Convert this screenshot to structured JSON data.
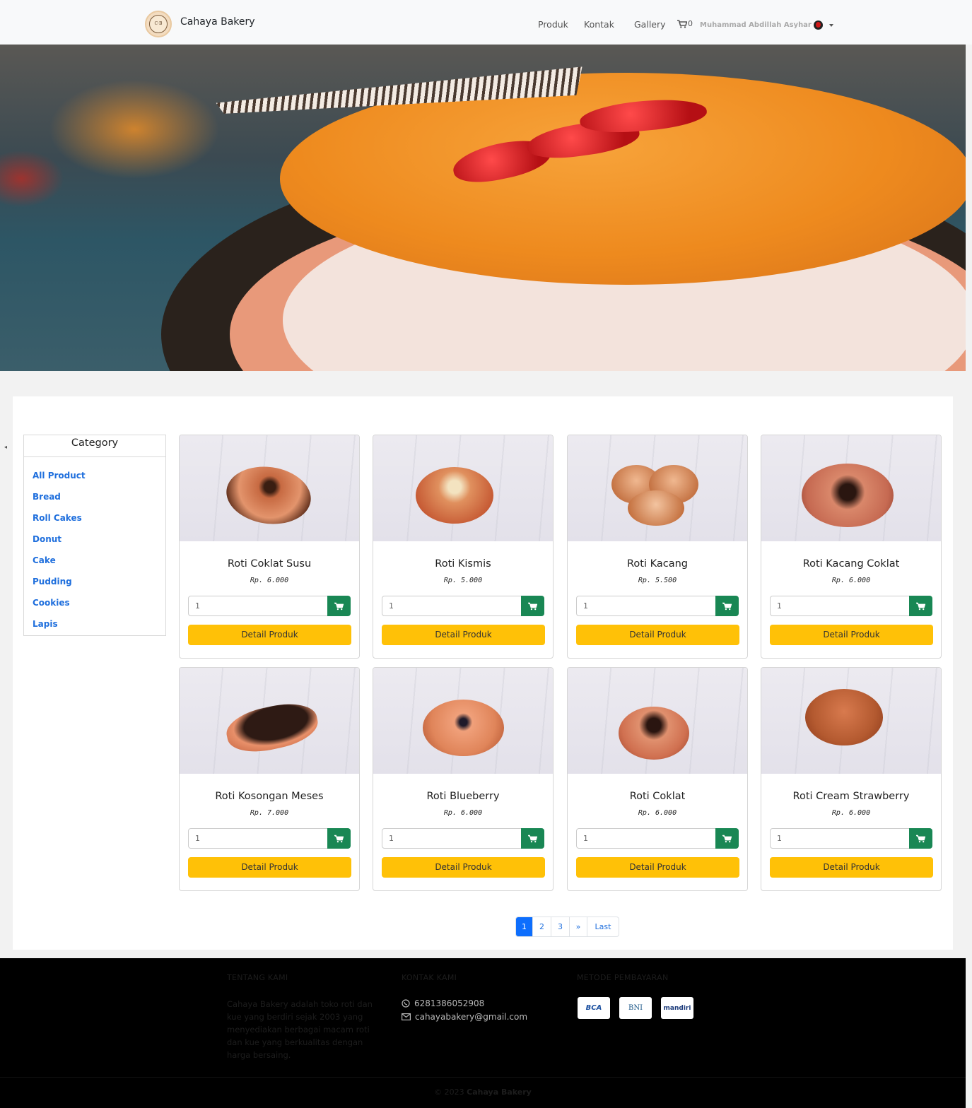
{
  "brand": {
    "name": "Cahaya Bakery",
    "logo_text": "Cahaya Bakery"
  },
  "nav": {
    "links": [
      "Produk",
      "Kontak",
      "Gallery"
    ],
    "cart_count": "0",
    "user_name": "Muhammad Abdillah Asyhar"
  },
  "sidebar": {
    "title": "Category",
    "items": [
      "All Product",
      "Bread",
      "Roll Cakes",
      "Donut",
      "Cake",
      "Pudding",
      "Cookies",
      "Lapis"
    ]
  },
  "products": [
    {
      "name": "Roti Coklat Susu",
      "price": "Rp. 6.000",
      "qty": "1",
      "detail": "Detail Produk"
    },
    {
      "name": "Roti Kismis",
      "price": "Rp. 5.000",
      "qty": "1",
      "detail": "Detail Produk"
    },
    {
      "name": "Roti Kacang",
      "price": "Rp. 5.500",
      "qty": "1",
      "detail": "Detail Produk"
    },
    {
      "name": "Roti Kacang Coklat",
      "price": "Rp. 6.000",
      "qty": "1",
      "detail": "Detail Produk"
    },
    {
      "name": "Roti Kosongan Meses",
      "price": "Rp. 7.000",
      "qty": "1",
      "detail": "Detail Produk"
    },
    {
      "name": "Roti Blueberry",
      "price": "Rp. 6.000",
      "qty": "1",
      "detail": "Detail Produk"
    },
    {
      "name": "Roti Coklat",
      "price": "Rp. 6.000",
      "qty": "1",
      "detail": "Detail Produk"
    },
    {
      "name": "Roti Cream Strawberry",
      "price": "Rp. 6.000",
      "qty": "1",
      "detail": "Detail Produk"
    }
  ],
  "pagination": {
    "pages": [
      "1",
      "2",
      "3"
    ],
    "next": "»",
    "last": "Last",
    "active": "1"
  },
  "footer": {
    "about_title": "TENTANG KAMI",
    "about_text": "Cahaya Bakery adalah toko roti dan kue yang berdiri sejak 2003 yang menyediakan berbagai macam roti dan kue yang berkualitas dengan harga bersaing.",
    "contact_title": "KONTAK KAMI",
    "phone": "6281386052908",
    "email": "cahayabakery@gmail.com",
    "payment_title": "METODE PEMBAYARAN",
    "payments": [
      "BCA",
      "BNI",
      "mandiri"
    ],
    "copyright_prefix": "© 2023",
    "copyright_name": "Cahaya Bakery"
  },
  "colors": {
    "cart_green": "#198754",
    "detail_yellow": "#ffc107",
    "link_blue": "#1f6fdd",
    "page_active": "#0d6efd"
  },
  "icons": {
    "cart": "shopping-cart-icon",
    "whatsapp": "whatsapp-icon",
    "email": "envelope-icon",
    "caret": "caret-down-icon"
  }
}
